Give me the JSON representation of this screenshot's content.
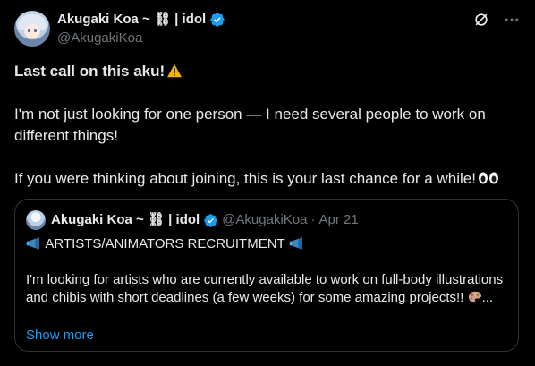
{
  "header": {
    "display_name": "Akugaki Koa ~ ⛓ | idol",
    "handle": "@AkugakiKoa"
  },
  "post": {
    "line1": "Last call on this aku!",
    "line2": "I'm not just looking for one person — I need several people to work on different things!",
    "line3": "If you were thinking about joining, this is your last chance for a while!"
  },
  "quote": {
    "display_name": "Akugaki Koa ~ ⛓ | idol",
    "handle": "@AkugakiKoa",
    "separator": "·",
    "date": "Apr 21",
    "title": "ARTISTS/ANIMATORS RECRUITMENT",
    "body": "I'm looking for artists who are currently available to work on full-body illustrations and chibis with short deadlines (a few weeks) for some amazing projects!!",
    "ellipsis": "...",
    "show_more": "Show more"
  },
  "icons": {
    "verified": "verified-badge-icon",
    "grok": "grok-icon",
    "more": "more-icon",
    "warning": "warning-emoji-icon",
    "eyes": "eyes-emoji-icon",
    "megaphone": "megaphone-emoji-icon",
    "palette": "palette-emoji-icon"
  },
  "colors": {
    "background": "#000000",
    "text": "#e7e9ea",
    "muted": "#71767b",
    "link": "#1d9bf0",
    "border": "#2f3336"
  }
}
